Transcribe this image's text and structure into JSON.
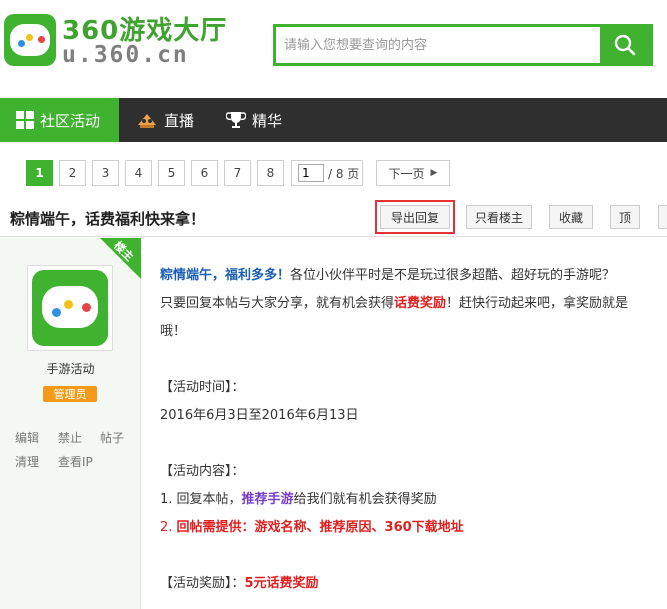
{
  "header": {
    "logo_title": "360游戏大厅",
    "logo_url": "u.360.cn",
    "search_placeholder": "请输入您想要查询的内容",
    "search_icon": "search-icon",
    "brand_color": "#3fb22f"
  },
  "nav": {
    "items": [
      {
        "label": "社区活动",
        "icon": "grid-icon"
      },
      {
        "label": "直播",
        "icon": "live-icon"
      },
      {
        "label": "精华",
        "icon": "trophy-icon"
      }
    ]
  },
  "pager": {
    "pages": [
      "1",
      "2",
      "3",
      "4",
      "5",
      "6",
      "7",
      "8"
    ],
    "current": "1",
    "jump_value": "1",
    "jump_total": "/ 8 页",
    "next_label": "下一页"
  },
  "thread": {
    "title": "粽情端午，话费福利快来拿！",
    "buttons": [
      "导出回复",
      "只看楼主",
      "收藏",
      "顶"
    ]
  },
  "post": {
    "floor_label": "楼主",
    "author_name": "手游活动",
    "role": "管理员",
    "admin_links": [
      "编辑",
      "禁止",
      "帖子",
      "清理",
      "查看IP"
    ],
    "intro_bold": "粽情端午，福利多多！",
    "intro_rest": "各位小伙伴平时是不是玩过很多超酷、超好玩的手游呢？",
    "line2_a": "只要回复本帖与大家分享，就有机会获得",
    "line2_red": "话费奖励",
    "line2_b": "！赶快行动起来吧，拿奖励就是",
    "line3": "哦！",
    "time_label": "【活动时间】：",
    "time_value": "2016年6月3日至2016年6月13日",
    "content_label": "【活动内容】：",
    "item1_a": "1. 回复本帖，",
    "item1_purple": "推荐手游",
    "item1_b": "给我们就有机会获得奖励",
    "item2_num": "2.",
    "item2_text": "回帖需提供：游戏名称、推荐原因、360下载地址",
    "reward_label": "【活动奖励】：",
    "reward_value": "5元话费奖励"
  }
}
